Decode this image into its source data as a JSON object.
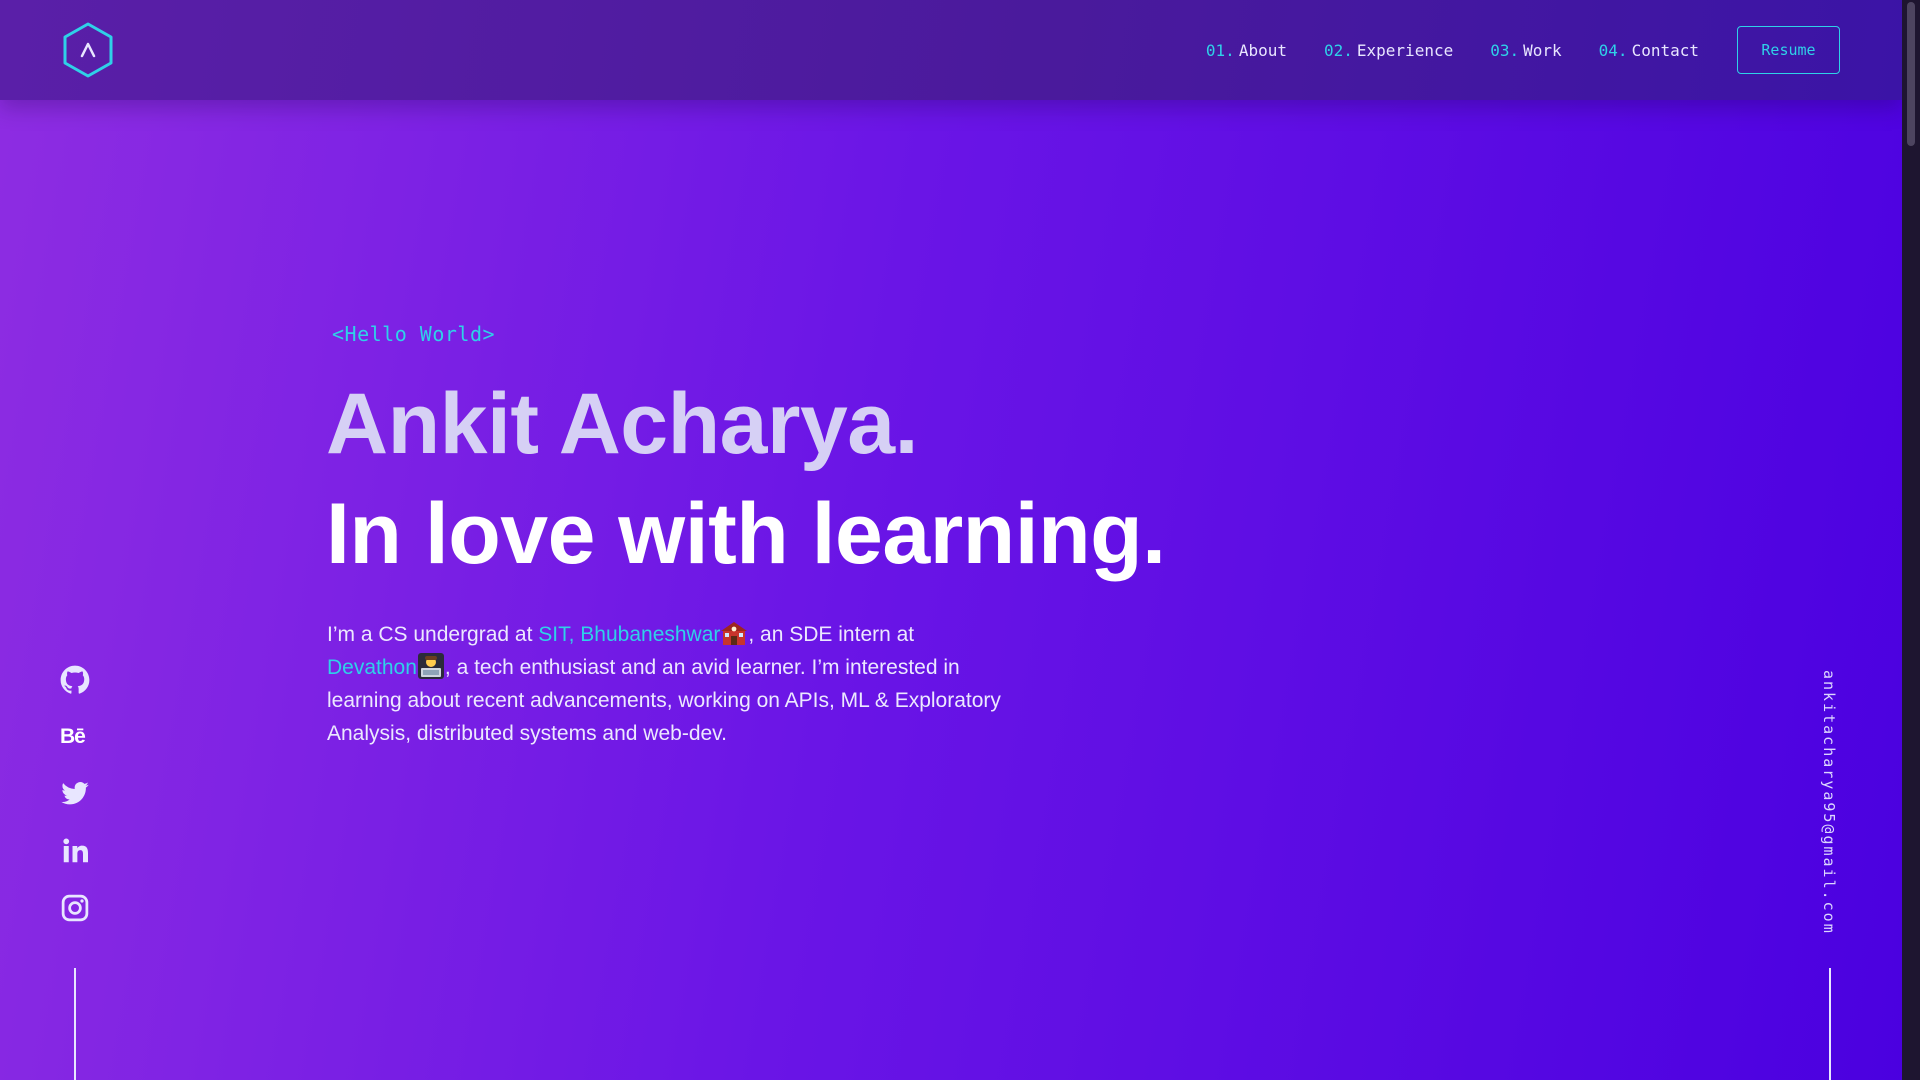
{
  "header": {
    "logo_icon": "hexagon-logo-icon",
    "nav": [
      {
        "num": "01.",
        "label": "About"
      },
      {
        "num": "02.",
        "label": "Experience"
      },
      {
        "num": "03.",
        "label": "Work"
      },
      {
        "num": "04.",
        "label": "Contact"
      }
    ],
    "resume_label": "Resume"
  },
  "hero": {
    "greeting": "<Hello World>",
    "name": "Ankit Acharya.",
    "tagline": "In love with learning.",
    "bio": {
      "part1": "I’m a CS undergrad at ",
      "link1": "SIT, Bhubaneshwar",
      "emoji1": "school-icon",
      "part2": ", an SDE intern at ",
      "link2": "Devathon",
      "emoji2": "laptop-person-icon",
      "part3": ", a tech enthusiast and an avid learner. I’m interested in learning about recent advancements, working on APIs, ML & Exploratory Analysis, distributed systems and web-dev."
    }
  },
  "social": [
    "github-icon",
    "behance-icon",
    "twitter-icon",
    "linkedin-icon",
    "instagram-icon"
  ],
  "behance_text": "Bē",
  "email": "ankitacharya95@gmail.com",
  "colors": {
    "accent": "#2fd1e8",
    "bg_start": "#8e2de2",
    "bg_end": "#4a00e0",
    "name": "#d6d0f5"
  }
}
